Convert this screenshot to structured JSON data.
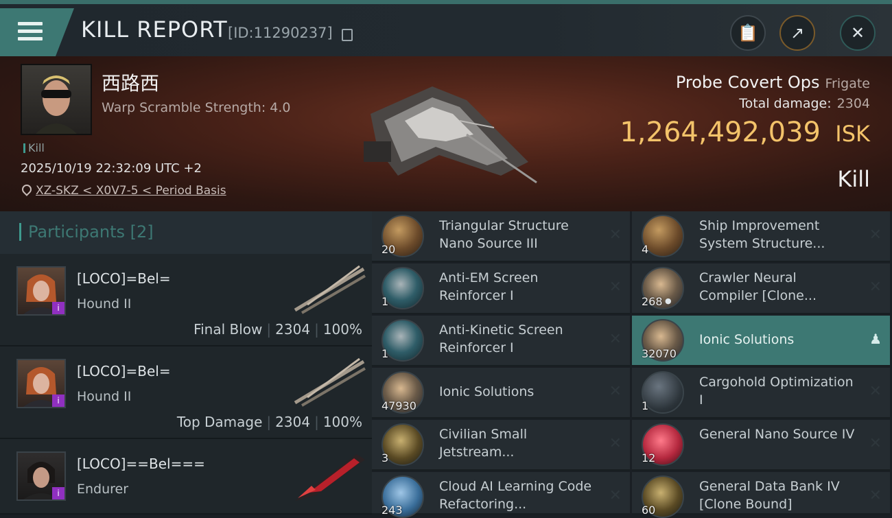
{
  "header": {
    "title": "KILL REPORT",
    "report_id": "[ID:11290237]"
  },
  "victim": {
    "name": "西路西",
    "warp_line": "Warp Scramble Strength: 4.0",
    "tag": "Kill",
    "datetime": "2025/10/19 22:32:09 UTC +2",
    "location": "XZ-SKZ < X0V7-5 < Period Basis",
    "ship_name": "Probe Covert Ops",
    "ship_class": "Frigate",
    "total_damage_label": "Total damage:",
    "total_damage": "2304",
    "isk_value": "1,264,492,039",
    "isk_unit": "ISK",
    "result": "Kill"
  },
  "participants": {
    "title": "Participants",
    "count": "[2]",
    "rows": [
      {
        "name": "[LOCO]=Bel=",
        "ship": "Hound II",
        "role": "Final Blow",
        "damage": "2304",
        "percent": "100%"
      },
      {
        "name": "[LOCO]=Bel=",
        "ship": "Hound II",
        "role": "Top Damage",
        "damage": "2304",
        "percent": "100%"
      },
      {
        "name": "[LOCO]==Bel===",
        "ship": "Endurer"
      }
    ]
  },
  "items": {
    "left": [
      {
        "qty": "20",
        "name": "Triangular Structure Nano Source III",
        "icon": "structure-orb"
      },
      {
        "qty": "1",
        "name": "Anti-EM Screen Reinforcer I",
        "icon": "shield-module"
      },
      {
        "qty": "1",
        "name": "Anti-Kinetic Screen Reinforcer I",
        "icon": "shield-module"
      },
      {
        "qty": "47930",
        "name": "Ionic Solutions",
        "icon": "canister"
      },
      {
        "qty": "3",
        "name": "Civilian Small Jetstream...",
        "icon": "turret"
      },
      {
        "qty": "243",
        "name": "Cloud AI Learning Code Refactoring...",
        "icon": "data-orb"
      }
    ],
    "right": [
      {
        "qty": "4",
        "name": "Ship Improvement System Structure...",
        "icon": "structure-orb"
      },
      {
        "qty": "268",
        "name": "Crawler Neural Compiler [Clone...",
        "icon": "canister"
      },
      {
        "qty": "32070",
        "name": "Ionic Solutions",
        "icon": "canister"
      },
      {
        "qty": "1",
        "name": "Cargohold Optimization I",
        "icon": "rig-module"
      },
      {
        "qty": "12",
        "name": "General Nano Source IV",
        "icon": "nano-orb"
      },
      {
        "qty": "60",
        "name": "General Data Bank IV [Clone Bound]",
        "icon": "data-bank"
      }
    ]
  },
  "colors": {
    "accent": "#3d7873",
    "isk": "#f3c36a",
    "badge": "#9030c0"
  }
}
